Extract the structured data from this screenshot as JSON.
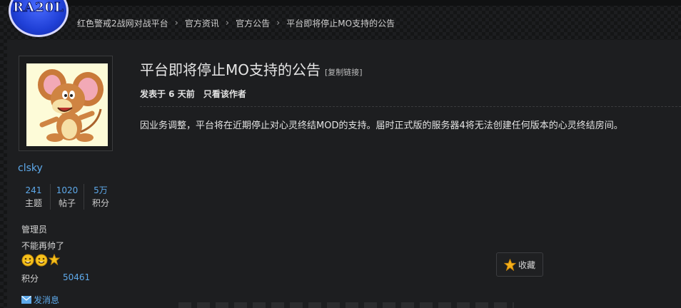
{
  "logo": {
    "text": "RA20L"
  },
  "breadcrumb": [
    {
      "label": "红色警戒2战网对战平台"
    },
    {
      "label": "官方资讯"
    },
    {
      "label": "官方公告"
    },
    {
      "label": "平台即将停止MO支持的公告"
    }
  ],
  "user": {
    "name": "clsky",
    "stats": [
      {
        "value": "241",
        "label": "主题"
      },
      {
        "value": "1020",
        "label": "帖子"
      },
      {
        "value": "5万",
        "label": "积分"
      }
    ],
    "role": "管理员",
    "tagline": "不能再帅了",
    "points_label": "积分",
    "points_value": "50461",
    "message_label": "发消息"
  },
  "post": {
    "title": "平台即将停止MO支持的公告",
    "copy_link": "[复制链接]",
    "posted": "发表于 6 天前",
    "only_author": "只看该作者",
    "body": "因业务调整，平台将在近期停止对心灵终结MOD的支持。届时正式版的服务器4将无法创建任何版本的心灵终结房间。",
    "favorite_label": "收藏"
  },
  "colors": {
    "link": "#5ea9ea",
    "background": "#1d1e20",
    "text": "#d6d6d6"
  }
}
